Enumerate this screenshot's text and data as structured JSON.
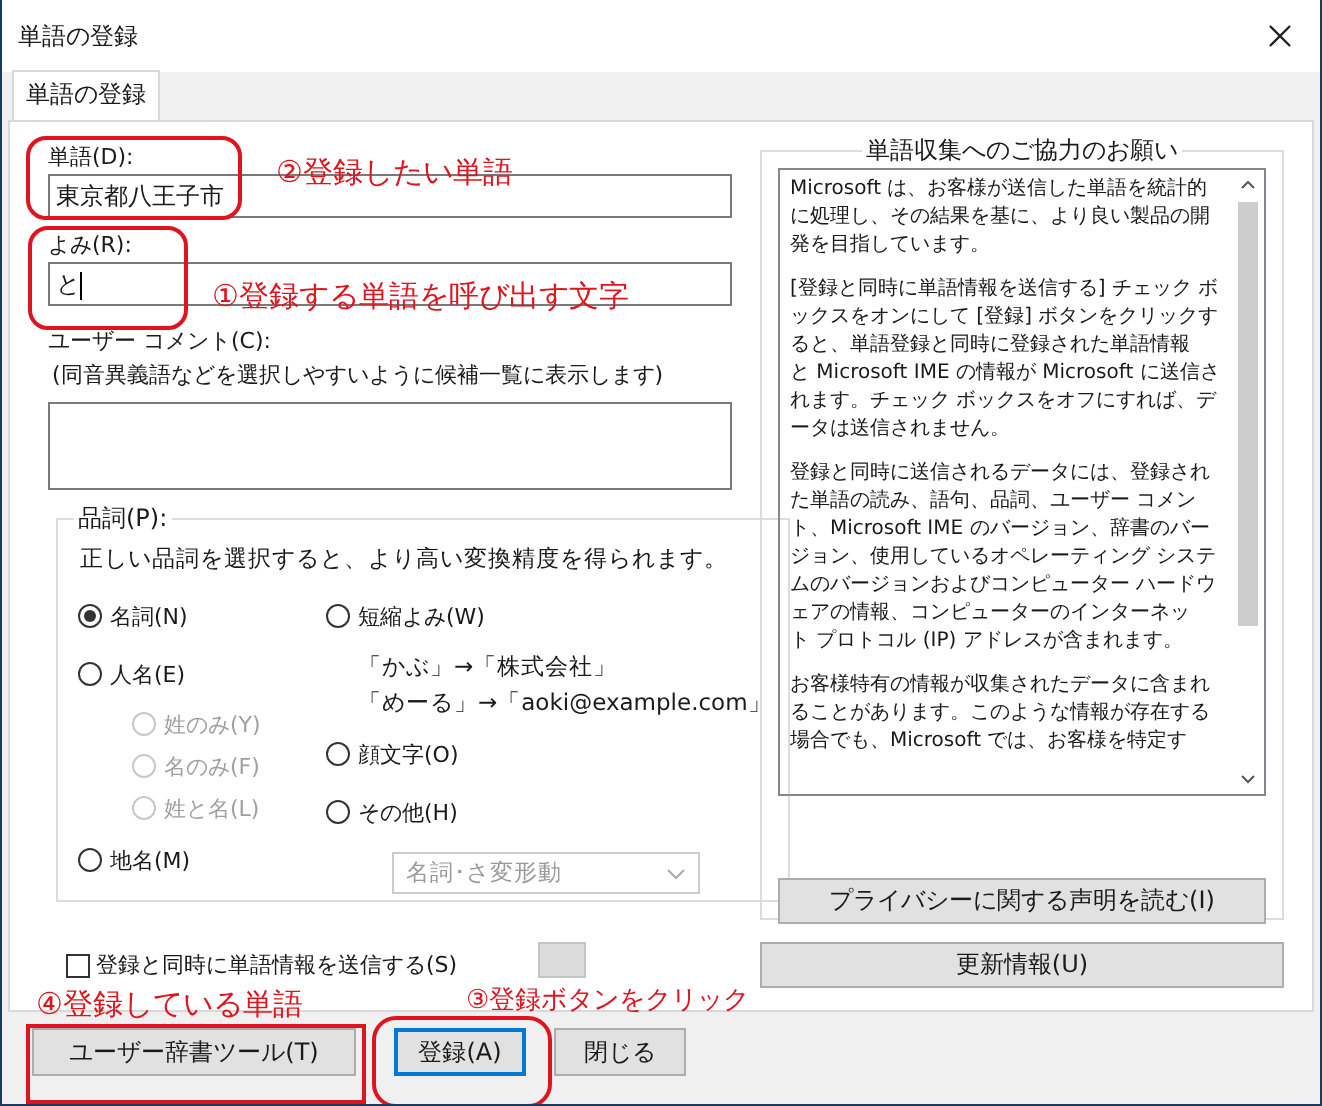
{
  "window": {
    "title": "単語の登録"
  },
  "tabs": [
    {
      "label": "単語の登録",
      "selected": true
    }
  ],
  "word": {
    "label": "単語(D):",
    "value": "東京都八王子市"
  },
  "reading": {
    "label": "よみ(R):",
    "value": "と"
  },
  "comment": {
    "label": "ユーザー コメント(C):",
    "hint": "(同音異義語などを選択しやすいように候補一覧に表示します)"
  },
  "part_of_speech": {
    "title": "品詞(P):",
    "description": "正しい品詞を選択すると、より高い変換精度を得られます。",
    "left_options": [
      {
        "label": "名詞(N)",
        "selected": true,
        "disabled": false
      },
      {
        "label": "人名(E)",
        "selected": false,
        "disabled": false,
        "children": [
          {
            "label": "姓のみ(Y)",
            "selected": false,
            "disabled": true
          },
          {
            "label": "名のみ(F)",
            "selected": false,
            "disabled": true
          },
          {
            "label": "姓と名(L)",
            "selected": false,
            "disabled": true
          }
        ]
      },
      {
        "label": "地名(M)",
        "selected": false,
        "disabled": false
      }
    ],
    "right_options": [
      {
        "label": "短縮よみ(W)",
        "selected": false,
        "disabled": false,
        "examples": [
          "「かぶ」→「株式会社」",
          "「めーる」→「aoki@example.com」"
        ]
      },
      {
        "label": "顔文字(O)",
        "selected": false,
        "disabled": false
      },
      {
        "label": "その他(H)",
        "selected": false,
        "disabled": false
      }
    ],
    "dropdown": {
      "value": "名詞･さ変形動",
      "disabled": true
    }
  },
  "send_checkbox": {
    "label": "登録と同時に単語情報を送信する(S)",
    "checked": false
  },
  "info_panel": {
    "title": "単語収集へのご協力のお願い",
    "paragraphs": [
      "Microsoft は、お客様が送信した単語を統計的に処理し、その結果を基に、より良い製品の開発を目指しています。",
      "[登録と同時に単語情報を送信する] チェック ボックスをオンにして [登録] ボタンをクリックすると、単語登録と同時に登録された単語情報と Microsoft IME の情報が Microsoft に送信されます。チェック ボックスをオフにすれば、データは送信されません。",
      "登録と同時に送信されるデータには、登録された単語の読み、語句、品詞、ユーザー コメント、Microsoft IME のバージョン、辞書のバージョン、使用しているオペレーティング システムのバージョンおよびコンピューター ハードウェアの情報、コンピューターのインターネット プロトコル (IP) アドレスが含まれます。",
      "お客様特有の情報が収集されたデータに含まれることがあります。このような情報が存在する場合でも、Microsoft では、お客様を特定す"
    ],
    "privacy_button": "プライバシーに関する声明を読む(I)"
  },
  "update_button": "更新情報(U)",
  "buttons": [
    {
      "label": "ユーザー辞書ツール(T)",
      "focused": false
    },
    {
      "label": "登録(A)",
      "focused": true
    },
    {
      "label": "閉じる",
      "focused": false
    }
  ],
  "annotations": [
    "②登録したい単語",
    "①登録する単語を呼び出す文字",
    "④登録している単語",
    "③登録ボタンをクリック"
  ]
}
